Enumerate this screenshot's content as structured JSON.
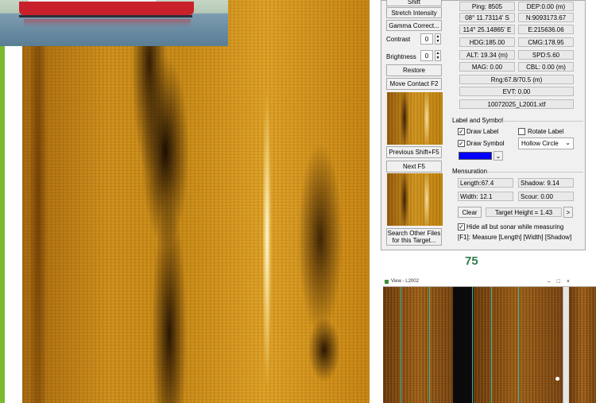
{
  "panel": {
    "top_button": "Shift",
    "stretch_intensity": "Stretch Intensity",
    "gamma_correct": "Gamma Correct...",
    "contrast_label": "Contrast",
    "contrast_value": "0",
    "brightness_label": "Brightness",
    "brightness_value": "0",
    "restore": "Restore",
    "move_contact": "Move Contact F2",
    "previous": "Previous Shift+F5",
    "next": "Next F5",
    "search_other": "Search Other Files for this Target...",
    "fields": {
      "ping": "Ping: 8505",
      "dep": "DEP:0.00 (m)",
      "lat": "08° 11.73114' S",
      "north": "N:9093173.67",
      "lon": "114° 25.14865' E",
      "east": "E:215636.06",
      "hdg": "HDG:185.00",
      "cmg": "CMG:178.95",
      "alt": "ALT: 19.34 (m)",
      "spd": "SPD:5.60",
      "mag": "MAG: 0.00",
      "cbl": "CBL: 0.00 (m)",
      "rng": "Rng:67.8/70.5 (m)",
      "evt": "EVT: 0.00",
      "file": "10072025_L2001.xtf"
    },
    "label_symbol": {
      "title": "Label and Symbol",
      "draw_label": "Draw Label",
      "rotate_label": "Rotate Label",
      "draw_symbol": "Draw Symbol",
      "symbol_shape": "Hollow Circle",
      "symbol_color": "#0000ff"
    },
    "mensuration": {
      "title": "Mensuration",
      "length": "Length:67.4",
      "shadow": "Shadow: 9.14",
      "width": "Width: 12.1",
      "scour": "Scour: 0.00",
      "clear": "Clear",
      "target_height": "Target Height = 1.43",
      "arrow": ">",
      "hide_all": "Hide all but sonar while measuring",
      "hint": "[F1]: Measure  [Length]  [Width] [Shadow]"
    }
  },
  "figure_number": "75",
  "viewer": {
    "title": "View - L2002",
    "controls": "– □ ×"
  }
}
